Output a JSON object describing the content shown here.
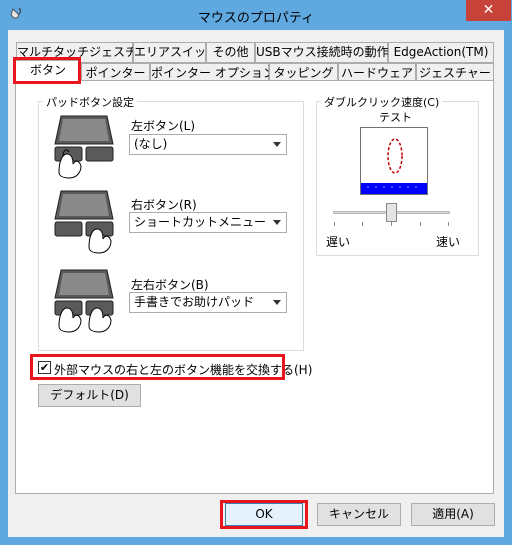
{
  "window": {
    "title": "マウスのプロパティ",
    "close_label": "✕",
    "icon": "mouse-icon"
  },
  "tabs_row1": [
    "マルチタッチジェスチャー",
    "エリアスイッチ",
    "その他",
    "USBマウス接続時の動作",
    "EdgeAction(TM)"
  ],
  "tabs_row2": [
    "ボタン",
    "ポインター",
    "ポインター オプション",
    "タッピング",
    "ハードウェア",
    "ジェスチャー"
  ],
  "selected_tab": "ボタン",
  "touchpad_settings": {
    "legend": "パッドボタン設定",
    "left": {
      "label": "左ボタン(L)",
      "value": "(なし)"
    },
    "right": {
      "label": "右ボタン(R)",
      "value": "ショートカットメニュー"
    },
    "both": {
      "label": "左右ボタン(B)",
      "value": "手書きでお助けパッド"
    }
  },
  "double_click": {
    "legend": "ダブルクリック速度(C)",
    "test_label": "テスト",
    "slow_label": "遅い",
    "fast_label": "速い",
    "speed_percent": 50
  },
  "swap_buttons": {
    "label": "外部マウスの右と左のボタン機能を交換する(H)",
    "checked": true,
    "check_mark": "✔"
  },
  "default_button": "デフォルト(D)",
  "footer": {
    "ok": "OK",
    "cancel": "キャンセル",
    "apply": "適用(A)"
  },
  "colors": {
    "highlight": "#e8141e",
    "titlebar": "#5fa8e0",
    "close": "#c7433a",
    "test_blue": "#0000ff"
  }
}
